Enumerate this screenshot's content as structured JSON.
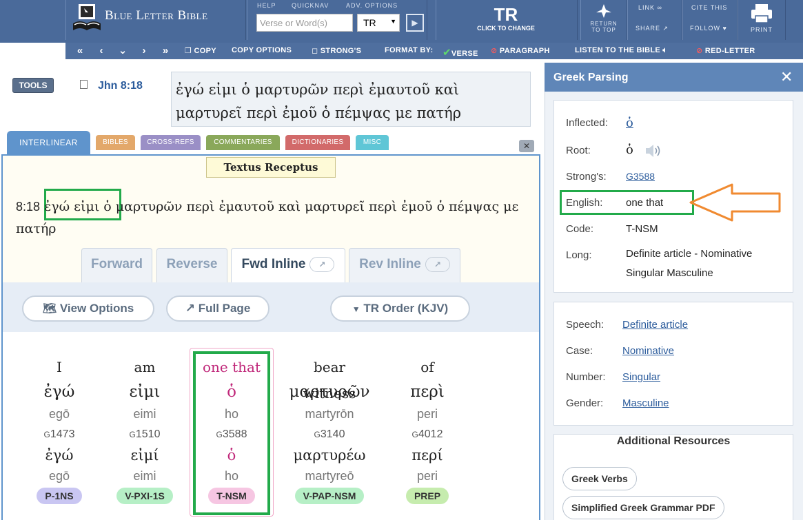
{
  "header": {
    "logo_text": "Blue Letter Bible",
    "help_label": "HELP",
    "quicknav_label": "QUICKNAV",
    "adv_options_label": "ADV. OPTIONS",
    "search_placeholder": "Verse or Word(s)",
    "version_select": "TR",
    "tr_big": "TR",
    "tr_click": "CLICK TO CHANGE",
    "return_top": "RETURN TO TOP",
    "link": "LINK",
    "share": "SHARE",
    "cite": "CITE THIS",
    "follow": "FOLLOW",
    "print": "PRINT"
  },
  "subbar": {
    "copy": "COPY",
    "copy_options": "COPY OPTIONS",
    "strongs": "STRONG'S",
    "format_by": "FORMAT BY:",
    "verse": "VERSE",
    "paragraph": "PARAGRAPH",
    "listen": "LISTEN TO THE BIBLE",
    "red_letter": "RED-LETTER"
  },
  "tools_label": "TOOLS",
  "verse_ref": "Jhn 8:18",
  "verse_text": "ἐγώ εἰμι ὁ μαρτυρῶν περὶ ἐμαυτοῦ καὶ μαρτυρεῖ περὶ ἐμοῦ ὁ πέμψας με πατήρ",
  "tabs": {
    "interlinear": "INTERLINEAR",
    "bibles": "BIBLES",
    "crossrefs": "CROSS-REFS",
    "commentaries": "COMMENTARIES",
    "dictionaries": "DICTIONARIES",
    "misc": "MISC"
  },
  "colors": {
    "bibles": "#e3a86a",
    "crossrefs": "#9a8fc6",
    "commentaries": "#8aa85a",
    "dictionaries": "#d26a6a",
    "misc": "#5fc6d6"
  },
  "panel": {
    "textus_label": "Textus Receptus",
    "verse_num": "8:18",
    "verse_line": "ἐγώ εἰμι ὁ μαρτυρῶν περὶ ἐμαυτοῦ καὶ μαρτυρεῖ περὶ ἐμοῦ ὁ πέμψας με πατήρ",
    "modes": [
      "Forward",
      "Reverse",
      "Fwd Inline",
      "Rev Inline"
    ],
    "view_options": "View Options",
    "full_page": "Full Page",
    "order": "TR Order (KJV)"
  },
  "words": [
    {
      "eng": "I",
      "greek": "ἐγώ",
      "translit": "egō",
      "strongs_prefix": "G",
      "strongs": "1473",
      "lemma": "ἐγώ",
      "lemma_translit": "egō",
      "code": "P-1NS",
      "code_color": "#c9c6f2"
    },
    {
      "eng": "am",
      "greek": "εἰμι",
      "translit": "eimi",
      "strongs_prefix": "G",
      "strongs": "1510",
      "lemma": "εἰμί",
      "lemma_translit": "eimi",
      "code": "V-PXI-1S",
      "code_color": "#b6efc6"
    },
    {
      "eng": "one that",
      "greek": "ὁ",
      "translit": "ho",
      "strongs_prefix": "G",
      "strongs": "3588",
      "lemma": "ὁ",
      "lemma_translit": "ho",
      "code": "T-NSM",
      "code_color": "#f6c6e2"
    },
    {
      "eng": "bear witness",
      "greek": "μαρτυρῶν",
      "translit": "martyrōn",
      "strongs_prefix": "G",
      "strongs": "3140",
      "lemma": "μαρτυρέω",
      "lemma_translit": "martyreō",
      "code": "V-PAP-NSM",
      "code_color": "#b6efc6"
    },
    {
      "eng": "of",
      "greek": "περὶ",
      "translit": "peri",
      "strongs_prefix": "G",
      "strongs": "4012",
      "lemma": "περί",
      "lemma_translit": "peri",
      "code": "PREP",
      "code_color": "#c6ecae"
    }
  ],
  "parsing": {
    "title": "Greek Parsing",
    "inflected_label": "Inflected:",
    "inflected": "ὁ",
    "root_label": "Root:",
    "root": "ὁ",
    "strongs_label": "Strong's:",
    "strongs": "G3588",
    "english_label": "English:",
    "english": "one that",
    "code_label": "Code:",
    "code": "T-NSM",
    "long_label": "Long:",
    "long_1": "Definite article - Nominative",
    "long_2": "Singular Masculine",
    "speech_label": "Speech:",
    "speech": "Definite article",
    "case_label": "Case:",
    "case": "Nominative",
    "number_label": "Number:",
    "number": "Singular",
    "gender_label": "Gender:",
    "gender": "Masculine",
    "resources_title": "Additional Resources",
    "res_1": "Greek Verbs",
    "res_2": "Simplified Greek Grammar PDF"
  }
}
